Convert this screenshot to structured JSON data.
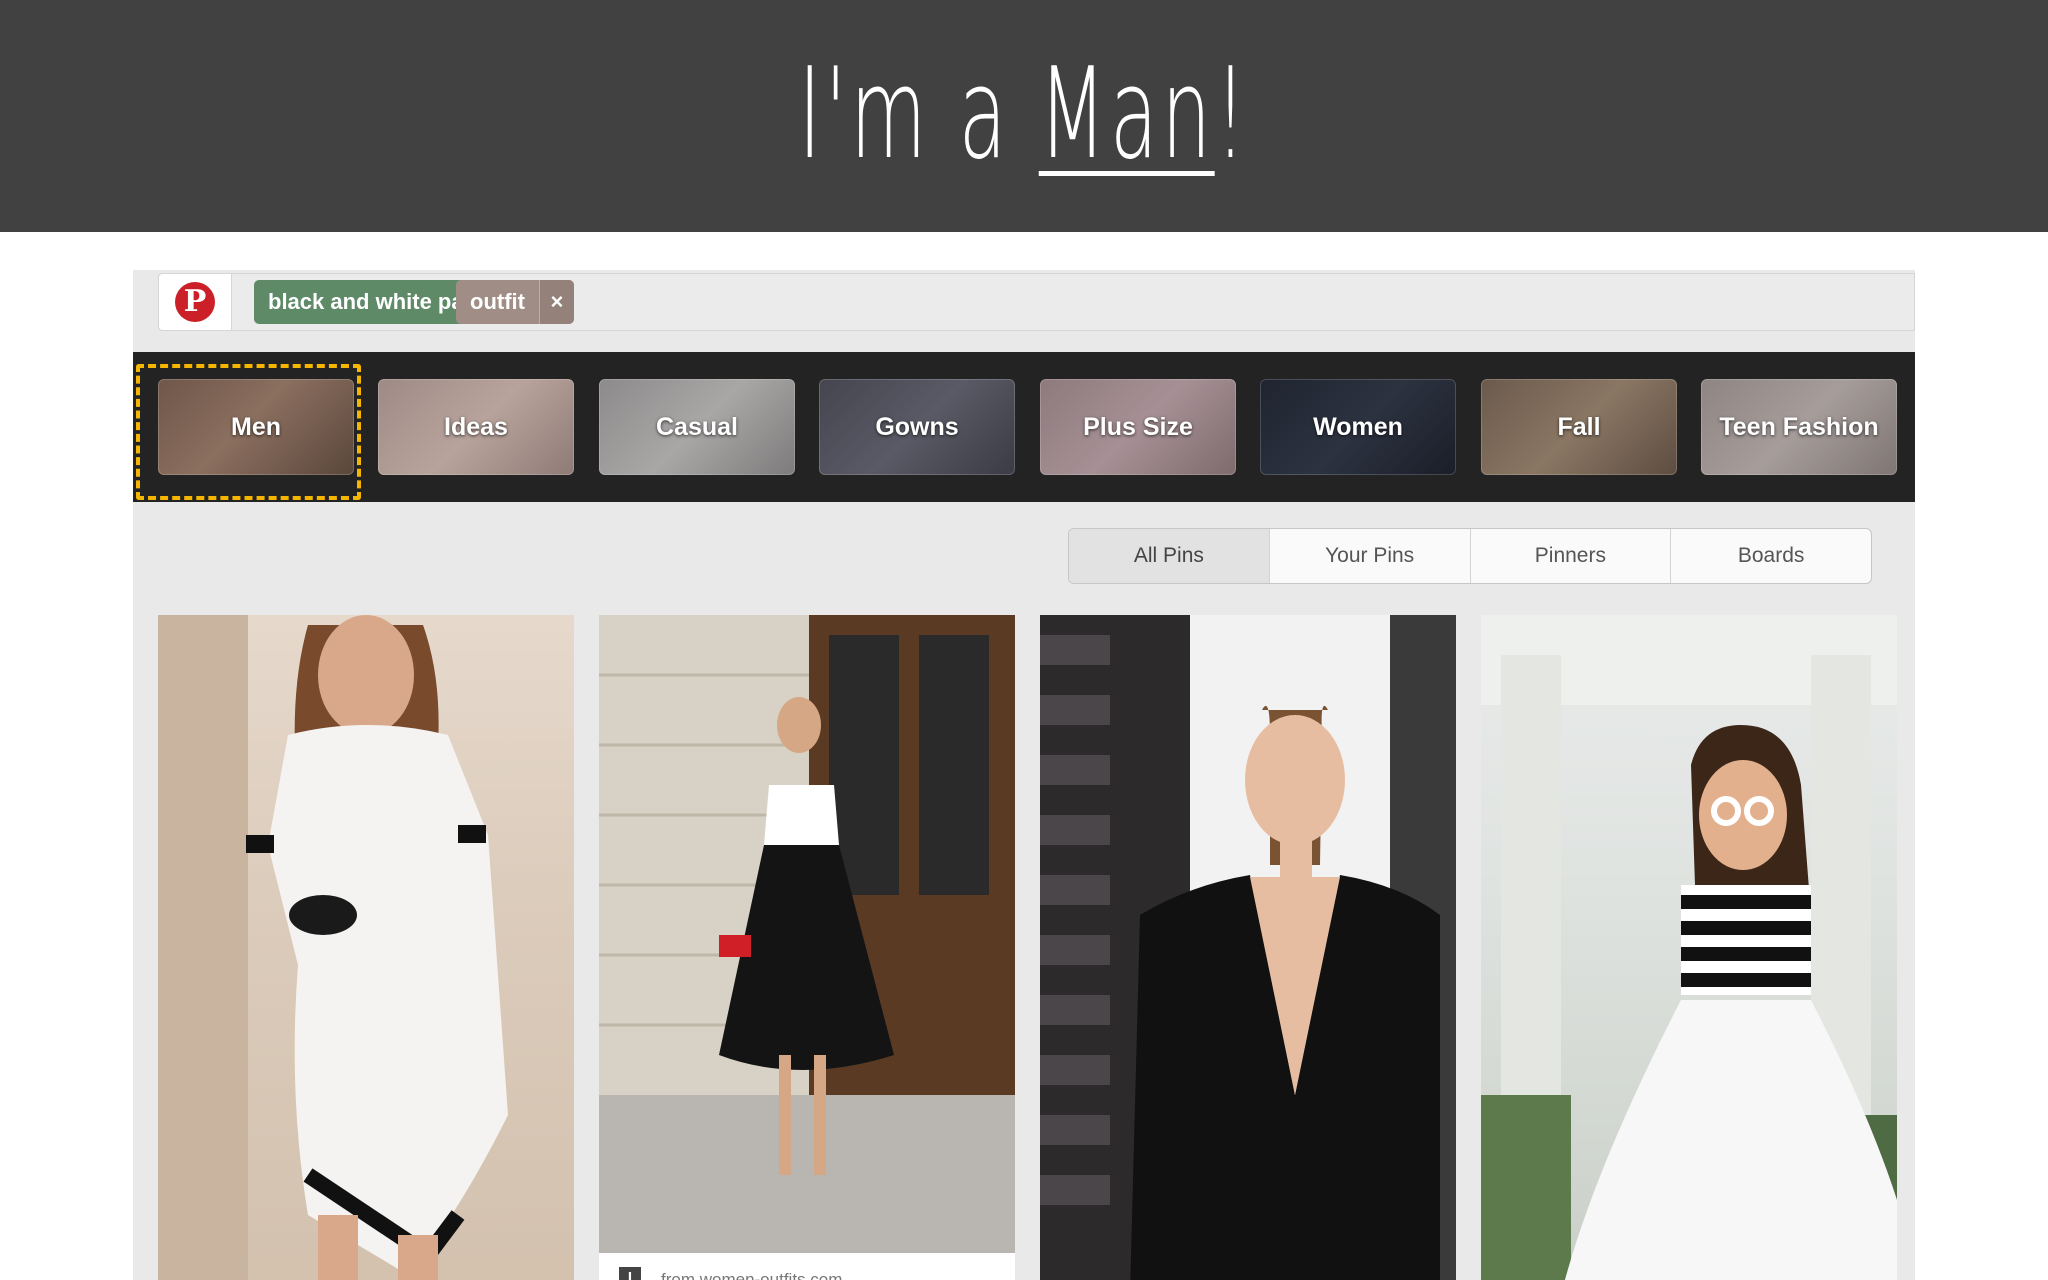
{
  "slide": {
    "title_prefix": "I'm a",
    "title_highlight": "Man",
    "title_suffix": "!"
  },
  "search": {
    "tokens": [
      {
        "label": "black and white party",
        "remove": "×"
      },
      {
        "label": "outfit",
        "remove": "×"
      }
    ]
  },
  "categories": [
    "Men",
    "Ideas",
    "Casual",
    "Gowns",
    "Plus Size",
    "Women",
    "Fall",
    "Teen Fashion"
  ],
  "filters": [
    "All Pins",
    "Your Pins",
    "Pinners",
    "Boards"
  ],
  "pins": [
    {
      "caption": ""
    },
    {
      "caption": "from women-outfits.com"
    },
    {
      "caption": ""
    },
    {
      "caption": ""
    }
  ],
  "colors": {
    "banner": "#414141",
    "pinterest_red": "#cb2027",
    "highlight_dash": "#f6b600",
    "chip_green": "#5e8a68",
    "chip_brown": "#a08e86"
  }
}
